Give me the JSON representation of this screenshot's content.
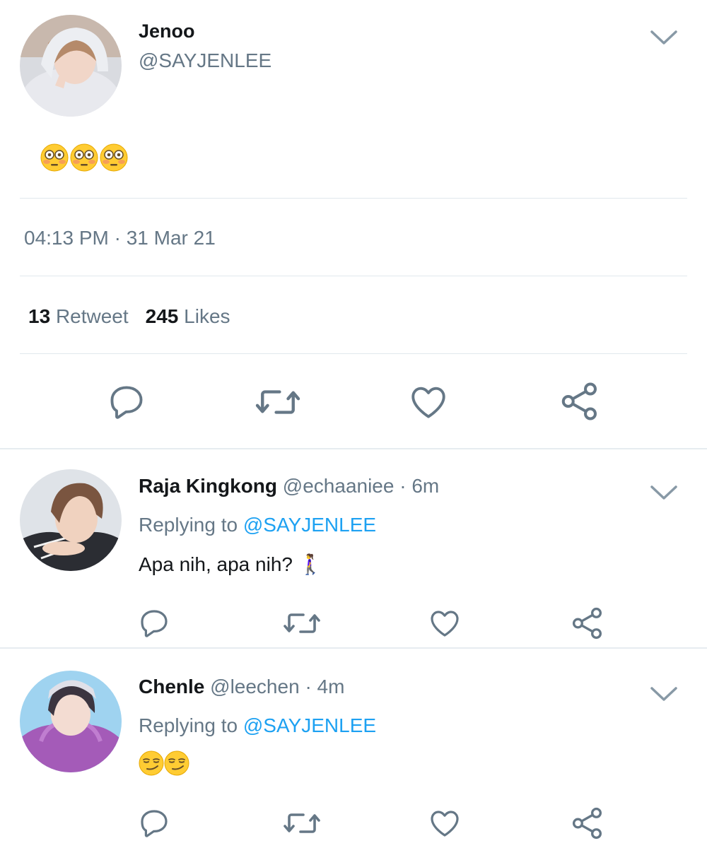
{
  "main_tweet": {
    "name": "Jenoo",
    "handle": "@SAYJENLEE",
    "emoji_text": "😳😳😳",
    "timestamp": "04:13 PM · 31 Mar 21",
    "retweet_count": "13",
    "retweet_label": "Retweet",
    "like_count": "245",
    "like_label": "Likes"
  },
  "replies": [
    {
      "name": "Raja Kingkong",
      "handle": "@echaaniee",
      "time": "· 6m",
      "replying_prefix": "Replying to",
      "replying_handle": "@SAYJENLEE",
      "text": "Apa nih, apa nih? 🚶‍♀️"
    },
    {
      "name": "Chenle",
      "handle": "@leechen",
      "time": "· 4m",
      "replying_prefix": "Replying to",
      "replying_handle": "@SAYJENLEE",
      "emoji_text": "😏😏"
    }
  ],
  "icons": {
    "chevron": "chevron-down-icon",
    "reply": "reply-icon",
    "retweet": "retweet-icon",
    "like": "heart-icon",
    "share": "share-icon",
    "flushed": "flushed-face-emoji",
    "smirk": "smirking-face-emoji",
    "walking": "woman-walking-emoji"
  },
  "colors": {
    "text": "#14171a",
    "muted": "#657786",
    "link": "#1da1f2",
    "divider": "#e1e8ed",
    "icon": "#657786"
  }
}
